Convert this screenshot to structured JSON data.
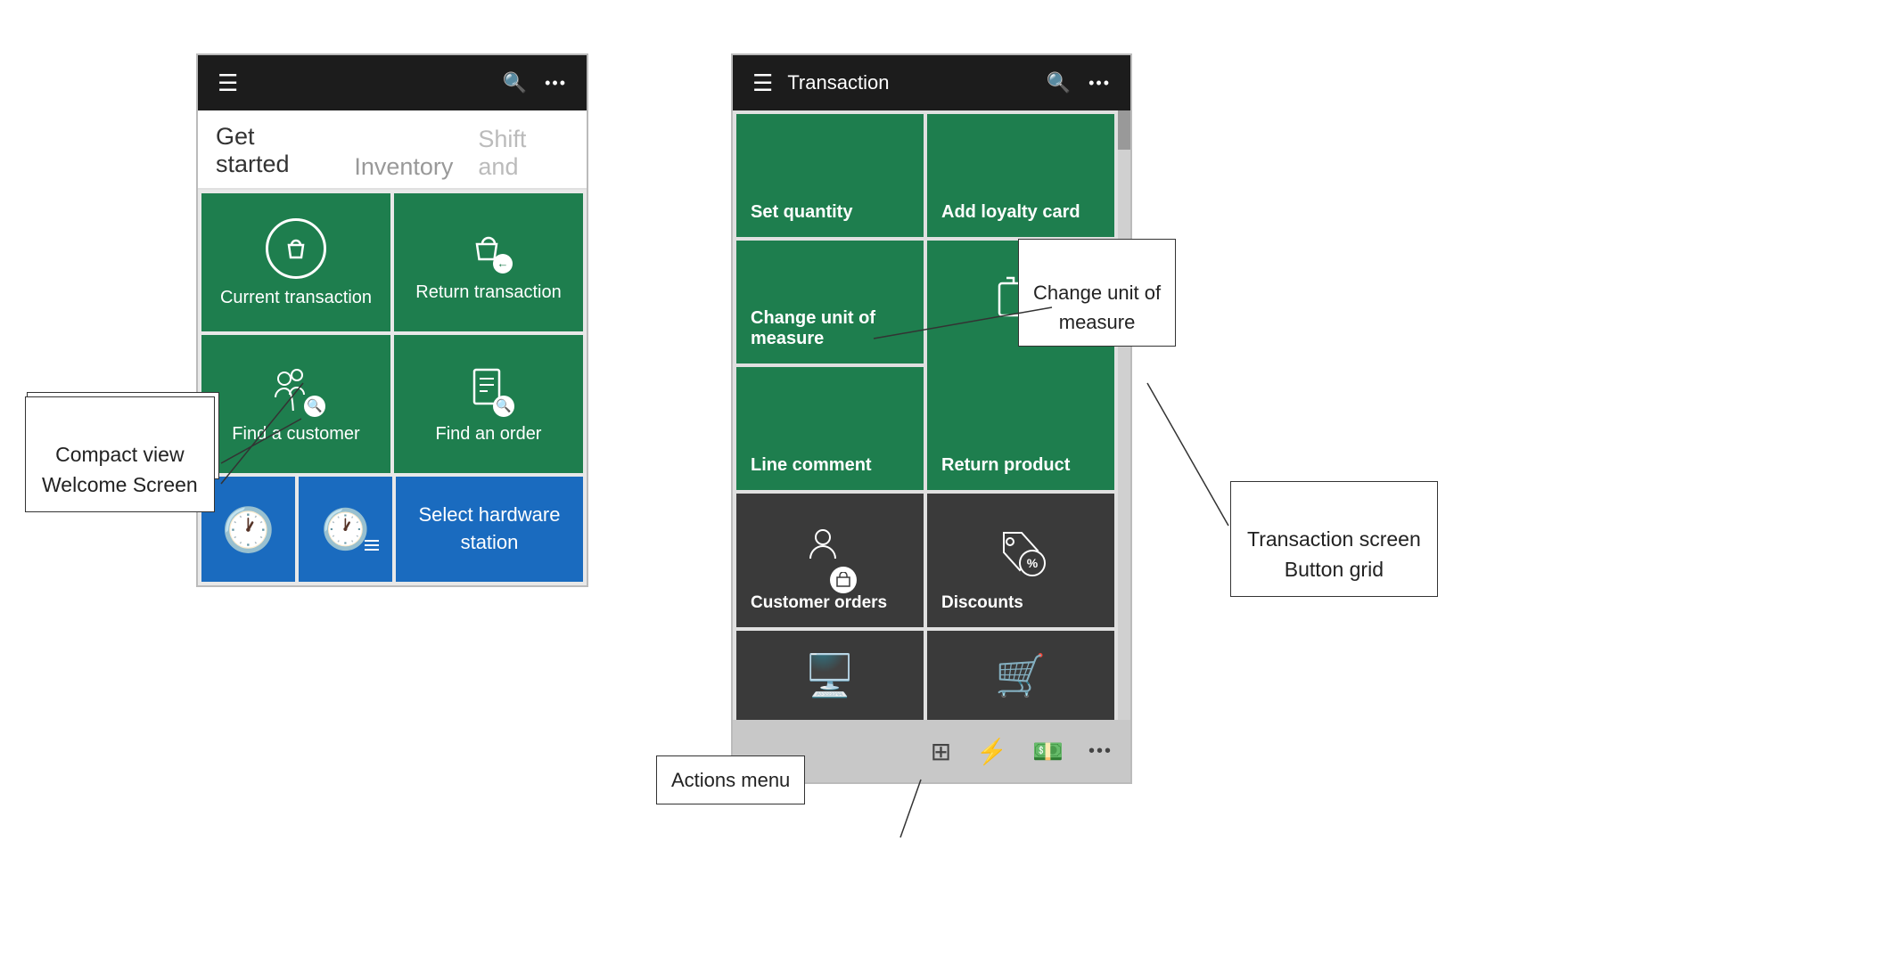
{
  "leftPhone": {
    "tabs": [
      {
        "label": "Get started",
        "active": true
      },
      {
        "label": "Inventory",
        "active": false
      },
      {
        "label": "Shift and",
        "active": false,
        "faded": true
      }
    ],
    "grid": [
      {
        "id": "current-transaction",
        "label": "Current transaction",
        "color": "green",
        "icon": "bag-circle"
      },
      {
        "id": "return-transaction",
        "label": "Return transaction",
        "color": "green",
        "icon": "return-bag"
      },
      {
        "id": "find-customer",
        "label": "Find a customer",
        "color": "green",
        "icon": "find-person"
      },
      {
        "id": "find-order",
        "label": "Find an order",
        "color": "green",
        "icon": "find-doc"
      }
    ],
    "bottomRow": [
      {
        "id": "clock1",
        "icon": "clock",
        "color": "blue",
        "label": ""
      },
      {
        "id": "clock2",
        "icon": "clock-list",
        "color": "blue",
        "label": ""
      },
      {
        "id": "hardware-station",
        "icon": "",
        "color": "blue",
        "label": "Select hardware station"
      }
    ]
  },
  "rightPhone": {
    "title": "Transaction",
    "grid": [
      {
        "id": "set-quantity",
        "label": "Set quantity",
        "color": "green",
        "icon": "",
        "span": 1
      },
      {
        "id": "add-loyalty",
        "label": "Add loyalty card",
        "color": "green",
        "icon": "",
        "span": 1
      },
      {
        "id": "change-uom",
        "label": "Change unit of\nmeasure",
        "color": "green",
        "icon": "",
        "span": 1
      },
      {
        "id": "return-product",
        "label": "Return product",
        "color": "green",
        "icon": "return-box",
        "span": 2
      },
      {
        "id": "line-comment",
        "label": "Line comment",
        "color": "green",
        "icon": "",
        "span": 1
      },
      {
        "id": "customer-orders",
        "label": "Customer orders",
        "color": "dark",
        "icon": "customer-box",
        "span": 1
      },
      {
        "id": "discounts",
        "label": "Discounts",
        "color": "dark",
        "icon": "discount-tag",
        "span": 1
      },
      {
        "id": "panel-button1",
        "label": "",
        "color": "dark",
        "icon": "register",
        "span": 1
      },
      {
        "id": "panel-button2",
        "label": "",
        "color": "dark",
        "icon": "cart",
        "span": 1
      }
    ],
    "bottomBar": [
      {
        "id": "calculator-icon",
        "icon": "⊞"
      },
      {
        "id": "lightning-icon",
        "icon": "⚡"
      },
      {
        "id": "cash-icon",
        "icon": "💵"
      },
      {
        "id": "more-icon",
        "icon": "•••"
      }
    ]
  },
  "annotations": {
    "compactViewLabel": "Compact view\nWelcome Screen",
    "transactionScreenLabel": "Transaction screen\nButton grid",
    "hardwareStationLabel": "Select hardware\nstation",
    "changeUomLabel": "Change unit of\nmeasure",
    "actionsMenuLabel": "Actions menu"
  }
}
